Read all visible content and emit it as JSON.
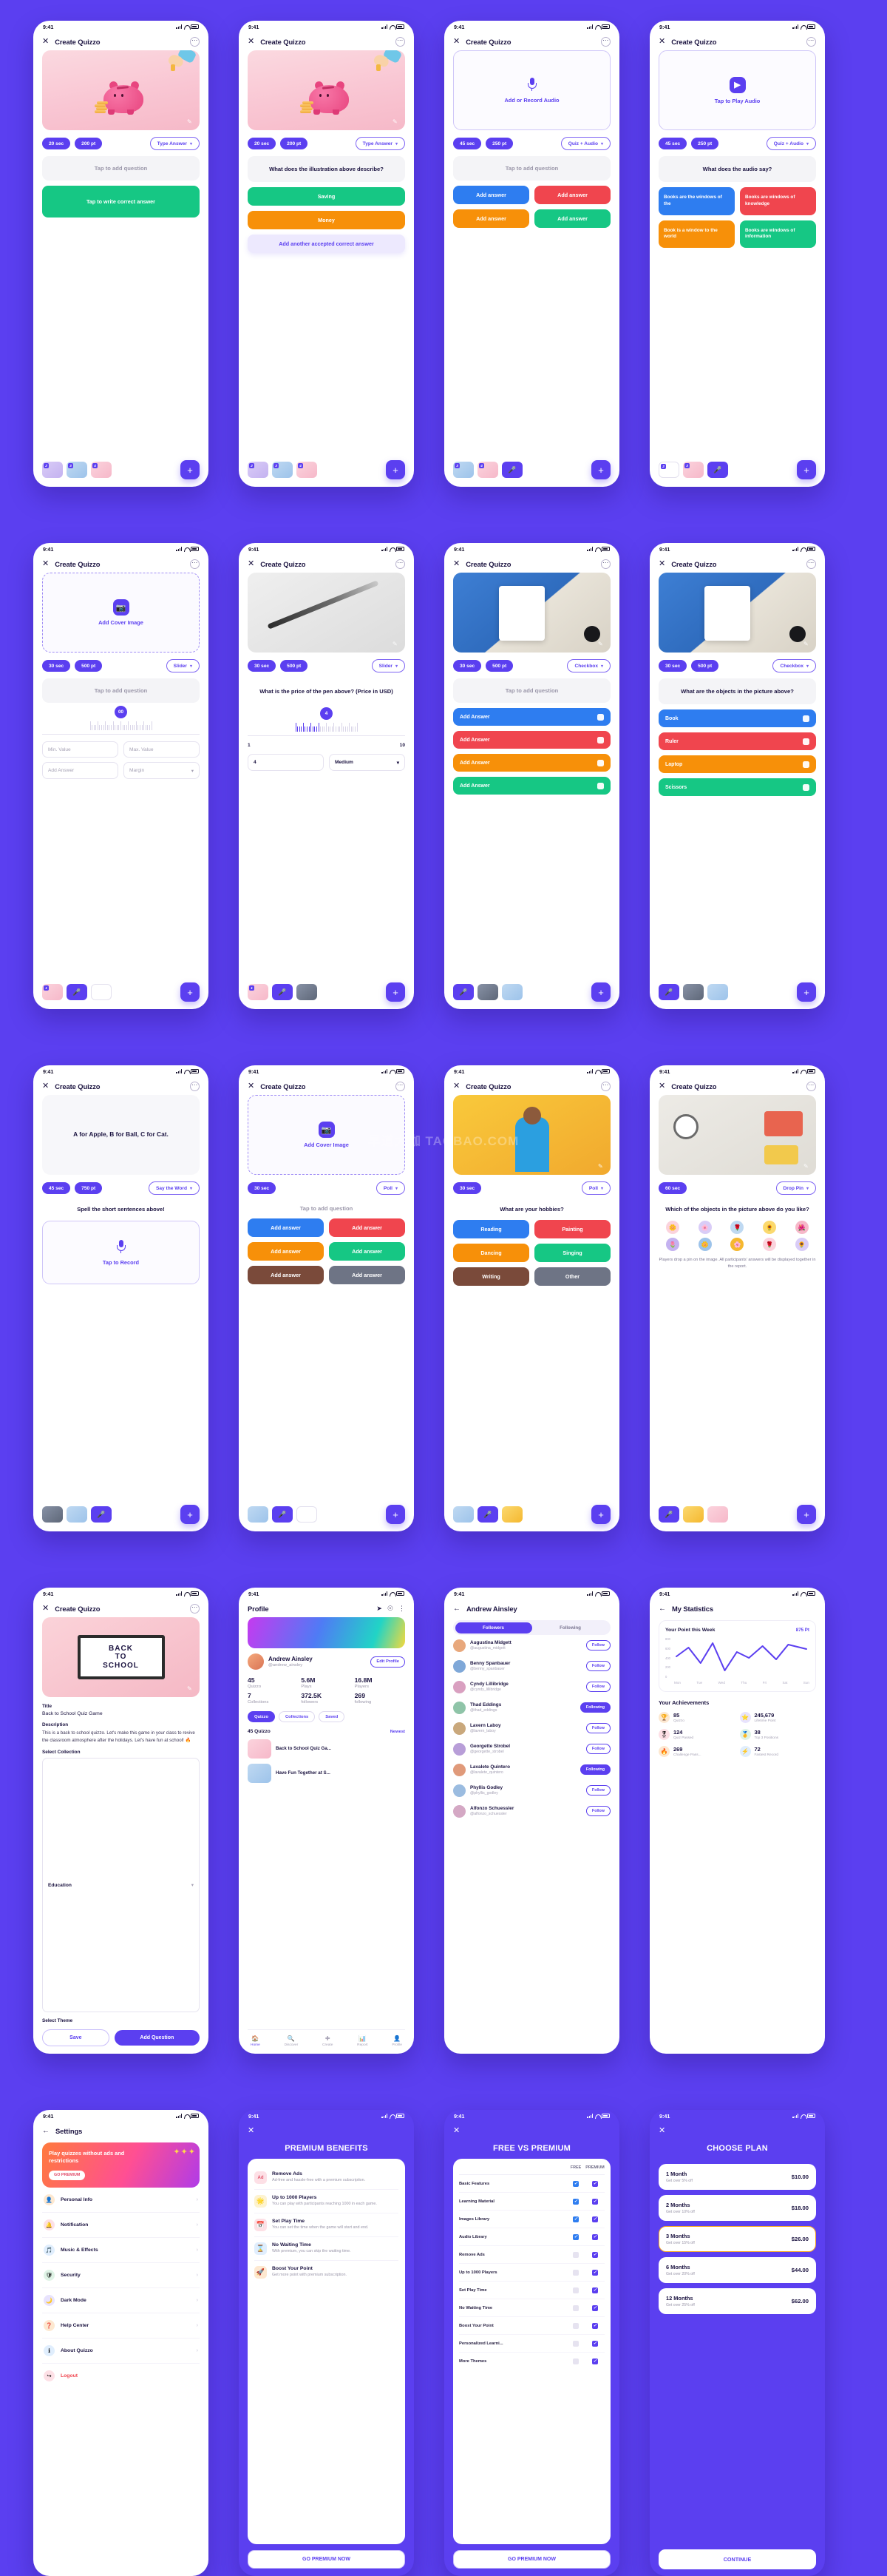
{
  "statusbar": {
    "time": "9:41"
  },
  "appbar": {
    "title": "Create Quizzo",
    "close": "✕",
    "more": "⋯",
    "back": "←"
  },
  "screens": {
    "s1": {
      "chips": [
        "20 sec",
        "200 pt",
        "Type Answer"
      ],
      "question_placeholder": "Tap to add question",
      "answer_placeholder": "Tap to write correct answer"
    },
    "s2": {
      "chips": [
        "20 sec",
        "200 pt",
        "Type Answer"
      ],
      "question": "What does the illustration above describe?",
      "answers": [
        "Saving",
        "Money"
      ],
      "add_more": "Add another accepted correct answer"
    },
    "s3": {
      "media_label": "Add or Record Audio",
      "chips": [
        "45 sec",
        "250 pt",
        "Quiz + Audio"
      ],
      "question_placeholder": "Tap to add question",
      "answers": [
        "Add answer",
        "Add answer",
        "Add answer",
        "Add answer"
      ]
    },
    "s4": {
      "media_label": "Tap to Play Audio",
      "chips": [
        "45 sec",
        "250 pt",
        "Quiz + Audio"
      ],
      "question": "What does the audio say?",
      "answers": [
        "Books are the windows of the",
        "Books are windows of knowledge",
        "Book is a window to the world",
        "Books are windows of information"
      ]
    },
    "s5": {
      "media_label": "Add Cover Image",
      "chips": [
        "30 sec",
        "500 pt",
        "Slider"
      ],
      "question_placeholder": "Tap to add question",
      "slider_value": "00",
      "fields": [
        "Min. Value",
        "Max. Value",
        "Add Answer",
        "Margin"
      ]
    },
    "s6": {
      "chips": [
        "30 sec",
        "500 pt",
        "Slider"
      ],
      "question": "What is the price of the pen above? (Price in USD)",
      "slider_value": "4",
      "scale_min": "1",
      "scale_max": "10",
      "fields": [
        "4",
        "Medium"
      ]
    },
    "s7": {
      "chips": [
        "30 sec",
        "500 pt",
        "Checkbox"
      ],
      "question_placeholder": "Tap to add question",
      "answers": [
        "Add Answer",
        "Add Answer",
        "Add Answer",
        "Add Answer"
      ]
    },
    "s8": {
      "chips": [
        "30 sec",
        "500 pt",
        "Checkbox"
      ],
      "question": "What are the objects in the picture above?",
      "answers": [
        "Book",
        "Ruler",
        "Laptop",
        "Scissors"
      ]
    },
    "s9": {
      "chips": [
        "45 sec",
        "750 pt",
        "Say the Word"
      ],
      "hero_text": "A for Apple, B for Ball, C for Cat.",
      "question": "Spell the short sentences above!",
      "record_label": "Tap to Record"
    },
    "s10": {
      "media_label": "Add Cover Image",
      "chips": [
        "30 sec",
        "Poll"
      ],
      "question_placeholder": "Tap to add question",
      "answers": [
        "Add answer",
        "Add answer",
        "Add answer",
        "Add answer",
        "Add answer",
        "Add answer"
      ]
    },
    "s11": {
      "chips": [
        "30 sec",
        "Poll"
      ],
      "question": "What are your hobbies?",
      "answers": [
        "Reading",
        "Painting",
        "Dancing",
        "Singing",
        "Writing",
        "Other"
      ]
    },
    "s12": {
      "chips": [
        "60 sec",
        "Drop Pin"
      ],
      "question": "Which of the objects in the picture above do you like?",
      "note": "Players drop a pin on the image. All participants' answers will be displayed together in the report."
    },
    "s13": {
      "labels": {
        "title": "Title",
        "description": "Description",
        "collection": "Select Collection",
        "theme": "Select Theme"
      },
      "title_value": "Back to School Quiz Game",
      "description_value": "This is a back to school quizzo. Let's make this game in your class to revive the classroom atmosphere after the holidays. Let's have fun at school! 🔥",
      "collection_value": "Education",
      "buttons": {
        "save": "Save",
        "add_question": "Add Question"
      }
    },
    "profile": {
      "title": "Profile",
      "name": "Andrew Ainsley",
      "handle": "@andrew_ainsley",
      "edit": "Edit Profile",
      "stats": [
        {
          "value": "45",
          "label": "Quizzo"
        },
        {
          "value": "5.6M",
          "label": "Plays"
        },
        {
          "value": "16.8M",
          "label": "Players"
        },
        {
          "value": "7",
          "label": "Collections"
        },
        {
          "value": "372.5K",
          "label": "followers"
        },
        {
          "value": "269",
          "label": "following"
        }
      ],
      "segments": [
        "Quizzo",
        "Collections",
        "Saved"
      ],
      "list_title": "45 Quizzo",
      "sort": "Newest",
      "items": [
        "Back to School Quiz Ga...",
        "Have Fun Together at S..."
      ],
      "tabs": [
        "Home",
        "Discover",
        "Create",
        "Report",
        "Profile"
      ]
    },
    "followers": {
      "title": "Andrew Ainsley",
      "tabs": [
        "Followers",
        "Following"
      ],
      "rows": [
        {
          "name": "Augustina Midgett",
          "handle": "@augustina_midgett",
          "action": "Follow"
        },
        {
          "name": "Benny Spanbauer",
          "handle": "@benny_spanbauer",
          "action": "Follow"
        },
        {
          "name": "Cyndy Lillibridge",
          "handle": "@cyndy_lillibridge",
          "action": "Follow"
        },
        {
          "name": "Thad Eddings",
          "handle": "@thad_eddings",
          "action": "Following"
        },
        {
          "name": "Lavern Laboy",
          "handle": "@lavern_laboy",
          "action": "Follow"
        },
        {
          "name": "Georgette Strobel",
          "handle": "@georgette_strobel",
          "action": "Follow"
        },
        {
          "name": "Lavalete Quintero",
          "handle": "@lavalete_quintero",
          "action": "Following"
        },
        {
          "name": "Phyllis Godley",
          "handle": "@phyllis_godley",
          "action": "Follow"
        },
        {
          "name": "Alfonzo Schuessler",
          "handle": "@alfonzo_schuessler",
          "action": "Follow"
        }
      ]
    },
    "statistics": {
      "title": "My Statistics",
      "card_title": "Your Point this Week",
      "card_points": "875 Pt",
      "achievements_title": "Your Achievements",
      "items": [
        {
          "value": "85",
          "label": "Quizzo",
          "icon": "🏆",
          "color": "#FDE8D0"
        },
        {
          "value": "245,679",
          "label": "Lifetime Point",
          "icon": "⭐",
          "color": "#E8E3FD"
        },
        {
          "value": "124",
          "label": "Quiz Passed",
          "icon": "🎖",
          "color": "#FDE0E6"
        },
        {
          "value": "38",
          "label": "Top 3 Positions",
          "icon": "🥇",
          "color": "#DFF3E6"
        },
        {
          "value": "269",
          "label": "Challenge Pass...",
          "icon": "🔥",
          "color": "#FDE8D0"
        },
        {
          "value": "72",
          "label": "Fastest Record",
          "icon": "⚡",
          "color": "#E0EEFD"
        }
      ]
    },
    "settings": {
      "title": "Settings",
      "promo_title": "Play quizzes without ads and restrictions",
      "promo_btn": "GO PREMIUM",
      "rows": [
        {
          "label": "Personal Info",
          "icon": "👤",
          "color": "#FDE8D0"
        },
        {
          "label": "Notification",
          "icon": "🔔",
          "color": "#FDE0E6"
        },
        {
          "label": "Music & Effects",
          "icon": "🎵",
          "color": "#E0EEFD"
        },
        {
          "label": "Security",
          "icon": "🛡",
          "color": "#DFF3E6"
        },
        {
          "label": "Dark Mode",
          "icon": "🌙",
          "color": "#E8E3FD"
        },
        {
          "label": "Help Center",
          "icon": "❓",
          "color": "#FDE8D0"
        },
        {
          "label": "About Quizzo",
          "icon": "ℹ",
          "color": "#E0EEFD"
        },
        {
          "label": "Logout",
          "icon": "↪",
          "color": "#FDE0E6"
        }
      ]
    },
    "premium": {
      "title": "PREMIUM BENEFITS",
      "cta": "GO PREMIUM NOW",
      "benefits": [
        {
          "title": "Remove Ads",
          "desc": "Ad-free and hassle-free with a premium subscription.",
          "icon": "Ad",
          "color": "#FDE0E6"
        },
        {
          "title": "Up to 1000 Players",
          "desc": "You can play with participants reaching 1000 in each game.",
          "icon": "🌟",
          "color": "#FDF3D0"
        },
        {
          "title": "Set Play Time",
          "desc": "You can set the time when the game will start and end.",
          "icon": "📅",
          "color": "#FDE0E6"
        },
        {
          "title": "No Waiting Time",
          "desc": "With premium, you can skip the waiting time.",
          "icon": "⌛",
          "color": "#E0EEFD"
        },
        {
          "title": "Boost Your Point",
          "desc": "Get more point with premium subscription.",
          "icon": "🚀",
          "color": "#FDE8D0"
        }
      ]
    },
    "compare": {
      "title": "FREE VS PREMIUM",
      "cta": "GO PREMIUM NOW",
      "columns": [
        "FREE",
        "PREMIUM"
      ],
      "rows": [
        {
          "label": "Basic Features",
          "free": true,
          "premium": true
        },
        {
          "label": "Learning Material",
          "free": true,
          "premium": true
        },
        {
          "label": "Images Library",
          "free": true,
          "premium": true
        },
        {
          "label": "Audio Library",
          "free": true,
          "premium": true
        },
        {
          "label": "Remove Ads",
          "free": false,
          "premium": true
        },
        {
          "label": "Up to 1000 Players",
          "free": false,
          "premium": true
        },
        {
          "label": "Set Play Time",
          "free": false,
          "premium": true
        },
        {
          "label": "No Waiting Time",
          "free": false,
          "premium": true
        },
        {
          "label": "Boost Your Point",
          "free": false,
          "premium": true
        },
        {
          "label": "Personalized Learni...",
          "free": false,
          "premium": true
        },
        {
          "label": "More Themes",
          "free": false,
          "premium": true
        }
      ]
    },
    "plans": {
      "title": "CHOOSE PLAN",
      "cta": "CONTINUE",
      "items": [
        {
          "name": "1 Month",
          "sub": "Get over 5% off",
          "price": "$10.00",
          "selected": false
        },
        {
          "name": "2 Months",
          "sub": "Get over 10% off",
          "price": "$18.00",
          "selected": false
        },
        {
          "name": "3 Months",
          "sub": "Get over 15% off",
          "price": "$26.00",
          "selected": true
        },
        {
          "name": "6 Months",
          "sub": "Get over 20% off",
          "price": "$44.00",
          "selected": false
        },
        {
          "name": "12 Months",
          "sub": "Get over 25% off",
          "price": "$62.00",
          "selected": false
        }
      ]
    }
  },
  "chart_data": {
    "type": "line",
    "title": "Your Point this Week",
    "annotation": "875 Pt",
    "categories": [
      "Mon",
      "Tue",
      "Wed",
      "Thu",
      "Fri",
      "Sat",
      "Sun"
    ],
    "values": [
      430,
      620,
      380,
      700,
      250,
      560,
      640
    ],
    "ylim": [
      0,
      800
    ],
    "yticks": [
      "800",
      "600",
      "400",
      "200",
      "0"
    ],
    "xlabel": "",
    "ylabel": "",
    "grid": false,
    "legend": false,
    "line_color": "#5B3FF0"
  },
  "colors": {
    "brand": "#5B3FF0",
    "green": "#16C784",
    "orange": "#F79009",
    "blue": "#2E7DF0",
    "red": "#F0454E",
    "teal": "#14B8A6",
    "gold": "#F5A623"
  },
  "watermark": "早道大咖 TAOBAO.COM"
}
